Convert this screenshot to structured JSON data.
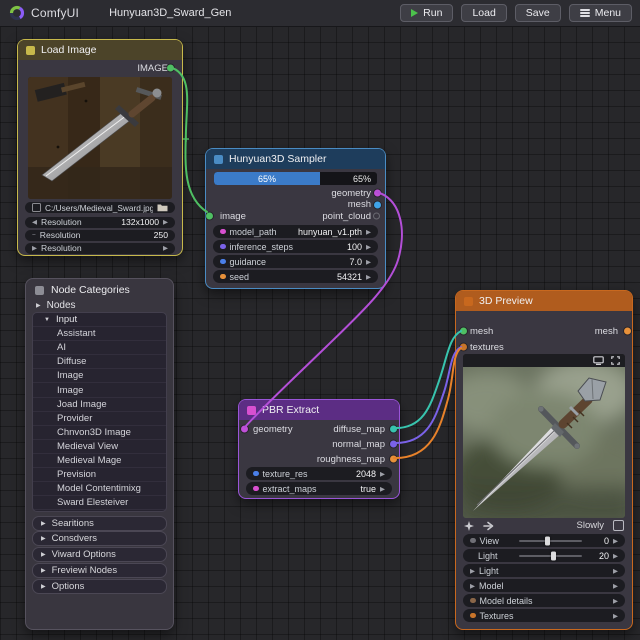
{
  "topbar": {
    "app_name": "ComfyUI",
    "workflow_title": "Hunyuan3D_Sward_Gen",
    "buttons": {
      "run": "Run",
      "load": "Load",
      "save": "Save",
      "menu": "Menu"
    }
  },
  "nodes": {
    "load_image": {
      "title": "Load Image",
      "output_label": "IMAGE",
      "path_value": "C:/Users/Medieval_Sward.jpg",
      "widgets": [
        {
          "left": "◀",
          "name": "Resolution",
          "value": "132x1000",
          "right": "▶"
        },
        {
          "left": "−",
          "name": "Resolution",
          "value": "250",
          "right": ""
        },
        {
          "left": "▶",
          "name": "Resolution",
          "value": "",
          "right": "▶"
        }
      ]
    },
    "sampler": {
      "title": "Hunyuan3D Sampler",
      "progress_width": "65%",
      "progress_label": "65%",
      "progress_right_label": "65%",
      "outputs": [
        "geometry",
        "mesh",
        "point_cloud"
      ],
      "input_label": "image",
      "widgets": [
        {
          "name": "model_path",
          "value": "hunyuan_v1.pth"
        },
        {
          "name": "inference_steps",
          "value": "100"
        },
        {
          "name": "guidance",
          "value": "7.0"
        },
        {
          "name": "seed",
          "value": "54321"
        }
      ]
    },
    "pbr": {
      "title": "PBR Extract",
      "input_label": "geometry",
      "outputs": [
        "diffuse_map",
        "normal_map",
        "roughness_map"
      ],
      "widgets": [
        {
          "name": "texture_res",
          "value": "2048"
        },
        {
          "name": "extract_maps",
          "value": "true"
        }
      ]
    },
    "preview": {
      "title": "3D Preview",
      "inputs": [
        "mesh",
        "textures"
      ],
      "output_label": "mesh",
      "slowly_label": "Slowly",
      "sliders": [
        {
          "name": "View",
          "value": "0"
        },
        {
          "name": "Light",
          "value": "20"
        }
      ],
      "sections": [
        {
          "name": "Light"
        },
        {
          "name": "Model"
        },
        {
          "name": "Model details"
        },
        {
          "name": "Textures"
        }
      ]
    }
  },
  "panel": {
    "title": "Node Categories",
    "root_label": "Nodes",
    "group_label": "Input",
    "items": [
      "Assistant",
      "AI",
      "Diffuse",
      "Image",
      "Image",
      "Joad Image",
      "Provider",
      "Chnvon3D Image",
      "Medieval View",
      "Medieval Mage",
      "Prevision",
      "Model Contentimixg",
      "Sward Elesteiver"
    ],
    "collapsed": [
      "Searitions",
      "Consdvers",
      "Viward Options",
      "Freviewi Nodes",
      "Options"
    ]
  },
  "colors": {
    "port_green": "#4fbf63",
    "port_blue": "#3fa3e8",
    "port_purple": "#c050d8",
    "port_violet": "#7a62e8",
    "port_royal": "#4a7fe8",
    "port_orange": "#e8913a",
    "port_teal": "#38c4ae",
    "port_magenta": "#d850d0",
    "port_gray": "#6a6a72",
    "dot_brown": "#8a6648",
    "dot_texture": "#c8742a",
    "wire_green": "#4fbf63",
    "wire_purple": "#b44fd8",
    "wire_teal": "#38c4ae",
    "wire_violet": "#7a62e8",
    "wire_orange": "#e8822a",
    "node_yellow": "#c7b94b",
    "node_blue": "#4a8cc4",
    "node_purple": "#9a55d8",
    "node_orange": "#c8681e",
    "progress_blue": "#3b7bc8",
    "run_green": "#4cc24c"
  }
}
